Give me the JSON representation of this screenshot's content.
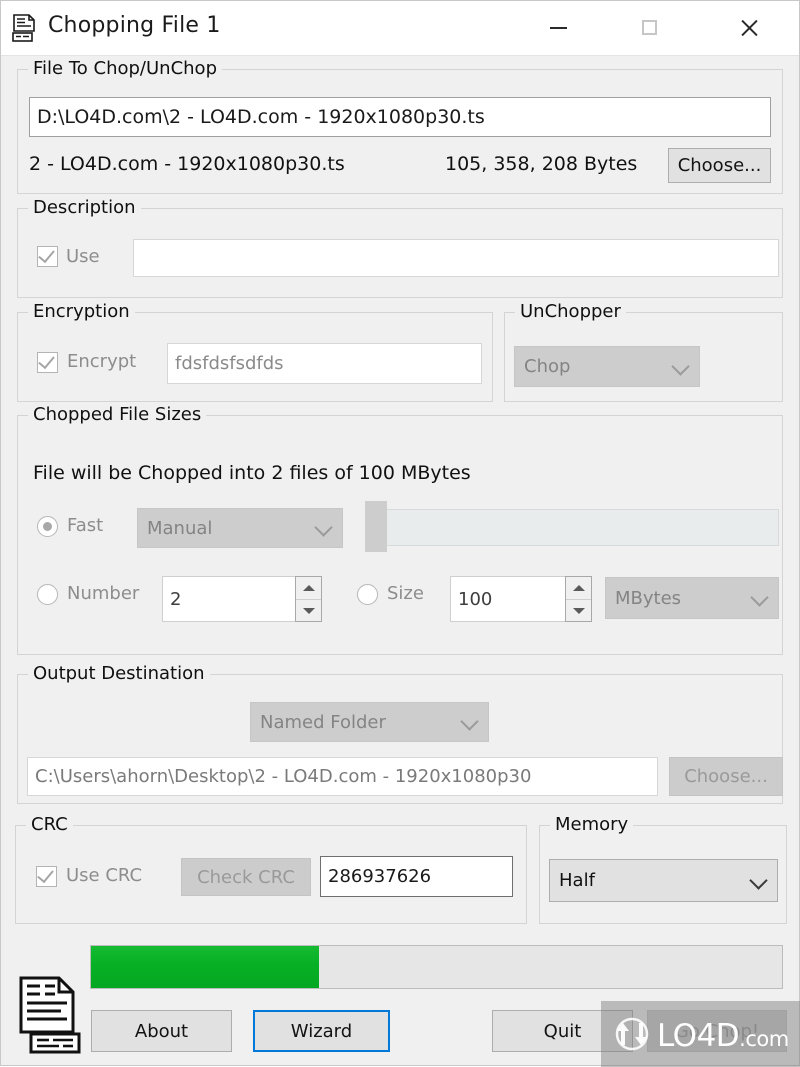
{
  "window": {
    "title": "Chopping File 1",
    "icon": "chop-file-icon",
    "controls": {
      "minimize": "minimize-icon",
      "maximize": "maximize-icon",
      "close": "close-icon"
    }
  },
  "file_to_chop": {
    "group_title": "File To Chop/UnChop",
    "path_value": "D:\\LO4D.com\\2 - LO4D.com - 1920x1080p30.ts",
    "file_name": "2 - LO4D.com - 1920x1080p30.ts",
    "file_size": "105, 358, 208  Bytes",
    "choose_label": "Choose..."
  },
  "description": {
    "group_title": "Description",
    "use_label": "Use",
    "use_checked": true,
    "text_value": ""
  },
  "encryption": {
    "group_title": "Encryption",
    "encrypt_label": "Encrypt",
    "encrypt_checked": true,
    "password_value": "fdsfdsfsdfds"
  },
  "unchopper": {
    "group_title": "UnChopper",
    "mode_value": "Chop"
  },
  "chopped_file_sizes": {
    "group_title": "Chopped File Sizes",
    "summary": "File will be Chopped into 2 files of 100 MBytes",
    "fast_label": "Fast",
    "fast_selected": true,
    "fast_mode_value": "Manual",
    "number_label": "Number",
    "number_selected": false,
    "number_value": "2",
    "size_label": "Size",
    "size_selected": false,
    "size_value": "100",
    "size_unit_value": "MBytes"
  },
  "output_destination": {
    "group_title": "Output Destination",
    "mode_value": "Named Folder",
    "path_value": "C:\\Users\\ahorn\\Desktop\\2 - LO4D.com - 1920x1080p30",
    "choose_label": "Choose..."
  },
  "crc": {
    "group_title": "CRC",
    "use_crc_label": "Use CRC",
    "use_crc_checked": true,
    "check_crc_label": "Check CRC",
    "crc_value": "286937626"
  },
  "memory": {
    "group_title": "Memory",
    "value": "Half"
  },
  "footer": {
    "progress_percent": 33,
    "progress_color": "#06b025",
    "about_label": "About",
    "wizard_label": "Wizard",
    "quit_label": "Quit",
    "go_chop_label": "Go Chop!",
    "doc_icon": "document-list-icon"
  },
  "watermark": {
    "text_main": "LO4D",
    "text_suffix": ".com"
  }
}
